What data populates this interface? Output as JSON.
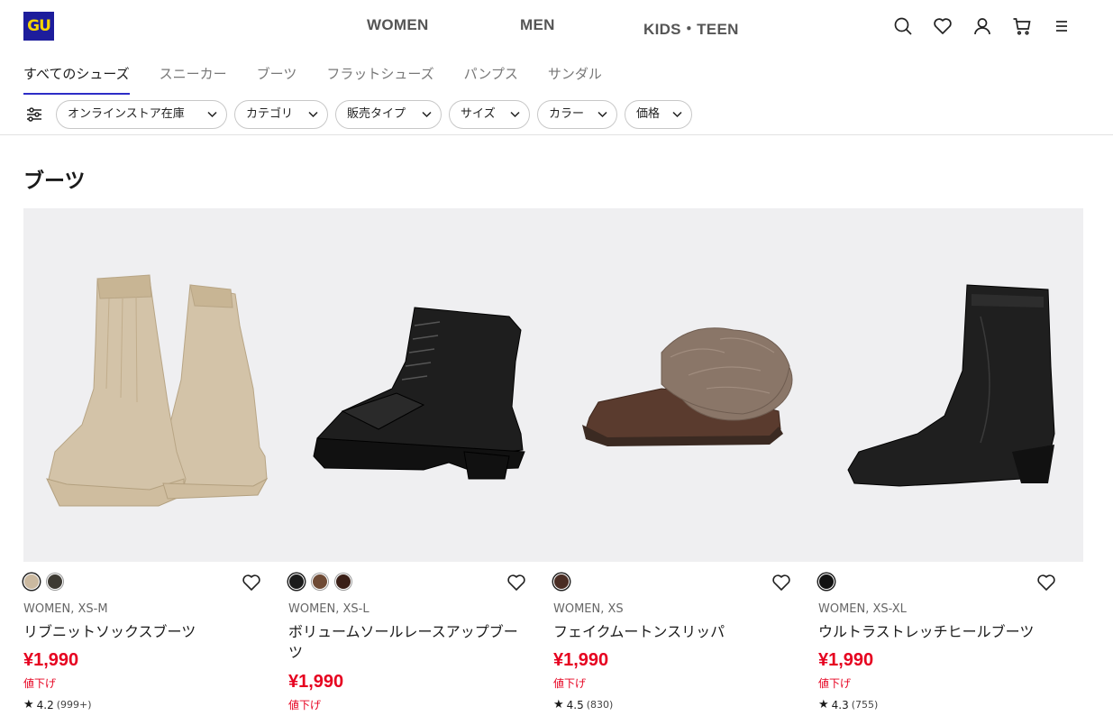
{
  "brand": {
    "logo_text": "GU",
    "logo_bg": "#1d1d9c",
    "logo_fg": "#f5d400"
  },
  "gender_nav": [
    "WOMEN",
    "MEN",
    "KIDS・TEEN"
  ],
  "header_icons": [
    "search-icon",
    "heart-icon",
    "account-icon",
    "cart-icon",
    "menu-icon"
  ],
  "tabs": [
    "すべてのシューズ",
    "スニーカー",
    "ブーツ",
    "フラットシューズ",
    "パンプス",
    "サンダル"
  ],
  "active_tab": "すべてのシューズ",
  "filters": [
    "オンラインストア在庫",
    "カテゴリ",
    "販売タイプ",
    "サイズ",
    "カラー",
    "価格"
  ],
  "section_title": "ブーツ",
  "accent_color": "#e6001f",
  "products": [
    {
      "meta": "WOMEN, XS-M",
      "name": "リブニットソックスブーツ",
      "price": "¥1,990",
      "sale_label": "値下げ",
      "rating": "4.2",
      "review_count": "(999+)",
      "swatches": [
        "#cbb9a0",
        "#3d3a33"
      ]
    },
    {
      "meta": "WOMEN, XS-L",
      "name": "ボリュームソールレースアップブーツ",
      "price": "¥1,990",
      "sale_label": "値下げ",
      "rating": "",
      "review_count": "",
      "swatches": [
        "#1b1b1b",
        "#6e4a35",
        "#3a1f17"
      ]
    },
    {
      "meta": "WOMEN, XS",
      "name": "フェイクムートンスリッパ",
      "price": "¥1,990",
      "sale_label": "値下げ",
      "rating": "4.5",
      "review_count": "(830)",
      "swatches": [
        "#4a2d24"
      ]
    },
    {
      "meta": "WOMEN, XS-XL",
      "name": "ウルトラストレッチヒールブーツ",
      "price": "¥1,990",
      "sale_label": "値下げ",
      "rating": "4.3",
      "review_count": "(755)",
      "swatches": [
        "#111111"
      ]
    }
  ]
}
